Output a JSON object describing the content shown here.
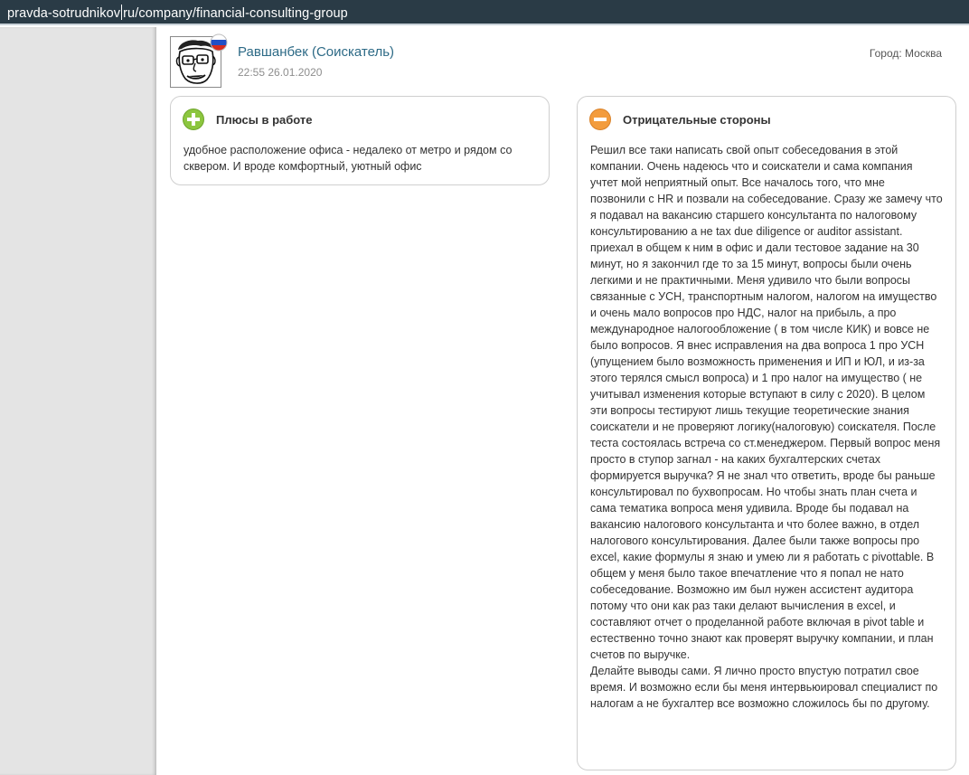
{
  "address_bar": {
    "url_before_caret": "pravda-sotrudnikov",
    "url_after_caret": "ru/company/financial-consulting-group"
  },
  "review": {
    "author": "Равшанбек (Соискатель)",
    "date": "22:55 26.01.2020",
    "city": "Город: Москва",
    "pros": {
      "title": "Плюсы в работе",
      "icon": "plus-circle-icon",
      "text": "удобное расположение офиса - недалеко от метро и рядом со сквером. И вроде комфортный, уютный офис"
    },
    "cons": {
      "title": "Отрицательные стороны",
      "icon": "minus-circle-icon",
      "paragraph1": "Решил все таки написать свой опыт собеседования в этой компании. Очень надеюсь что и соискатели и сама компания учтет мой неприятный опыт. Все началось того, что мне позвонили с HR и позвали на собеседование. Сразу же замечу что я подавал на вакансию старшего консультанта по налоговому консультированию а не tax due diligence or auditor assistant. приехал в общем к ним в офис и дали тестовое задание на 30 минут, но я закончил где то за 15 минут, вопросы были очень легкими и не практичными. Меня удивило что были вопросы связанные с УСН, транспортным налогом, налогом на имущество и очень мало вопросов про НДС, налог на прибыль, а про международное налогообложение ( в том числе КИК) и вовсе не было вопросов. Я внес исправления на два вопроса 1 про УСН (упущением было возможность применения и ИП и ЮЛ, и из-за этого терялся смысл вопроса) и 1 про налог на имущество ( не учитывал изменения которые вступают в силу с 2020). В целом эти вопросы тестируют лишь текущие теоретические знания соискатели и не проверяют логику(налоговую) соискателя. После теста состоялась встреча со ст.менеджером. Первый вопрос меня просто в ступор загнал - на каких бухгалтерских счетах формируется выручка? Я не знал что ответить, вроде бы раньше консультировал по бухвопросам. Но чтобы знать план счета и сама тематика вопроса меня удивила. Вроде бы подавал на вакансию налогового консультанта и что более важно, в отдел налогового консультирования. Далее были также вопросы про excel, какие формулы я знаю и умею ли я работать с pivottable. В общем у меня было такое впечатление что я попал не нато собеседование. Возможно им был нужен ассистент аудитора потому что они как раз таки делают вычисления в excel, и составляют отчет о проделанной работе включая в pivot table и естественно точно знают как проверят выручку компании, и план счетов по выручке.",
      "paragraph2": "Делайте выводы сами. Я лично просто впустую потратил свое время. И возможно если бы меня интервьюировал специалист по налогам а не бухгалтер все возможно сложилось бы по другому."
    }
  },
  "colors": {
    "address_bar_bg": "#2a3b46",
    "author_link": "#2d6a86",
    "pros_badge": "#8cc63f",
    "cons_badge": "#f39c3d"
  }
}
